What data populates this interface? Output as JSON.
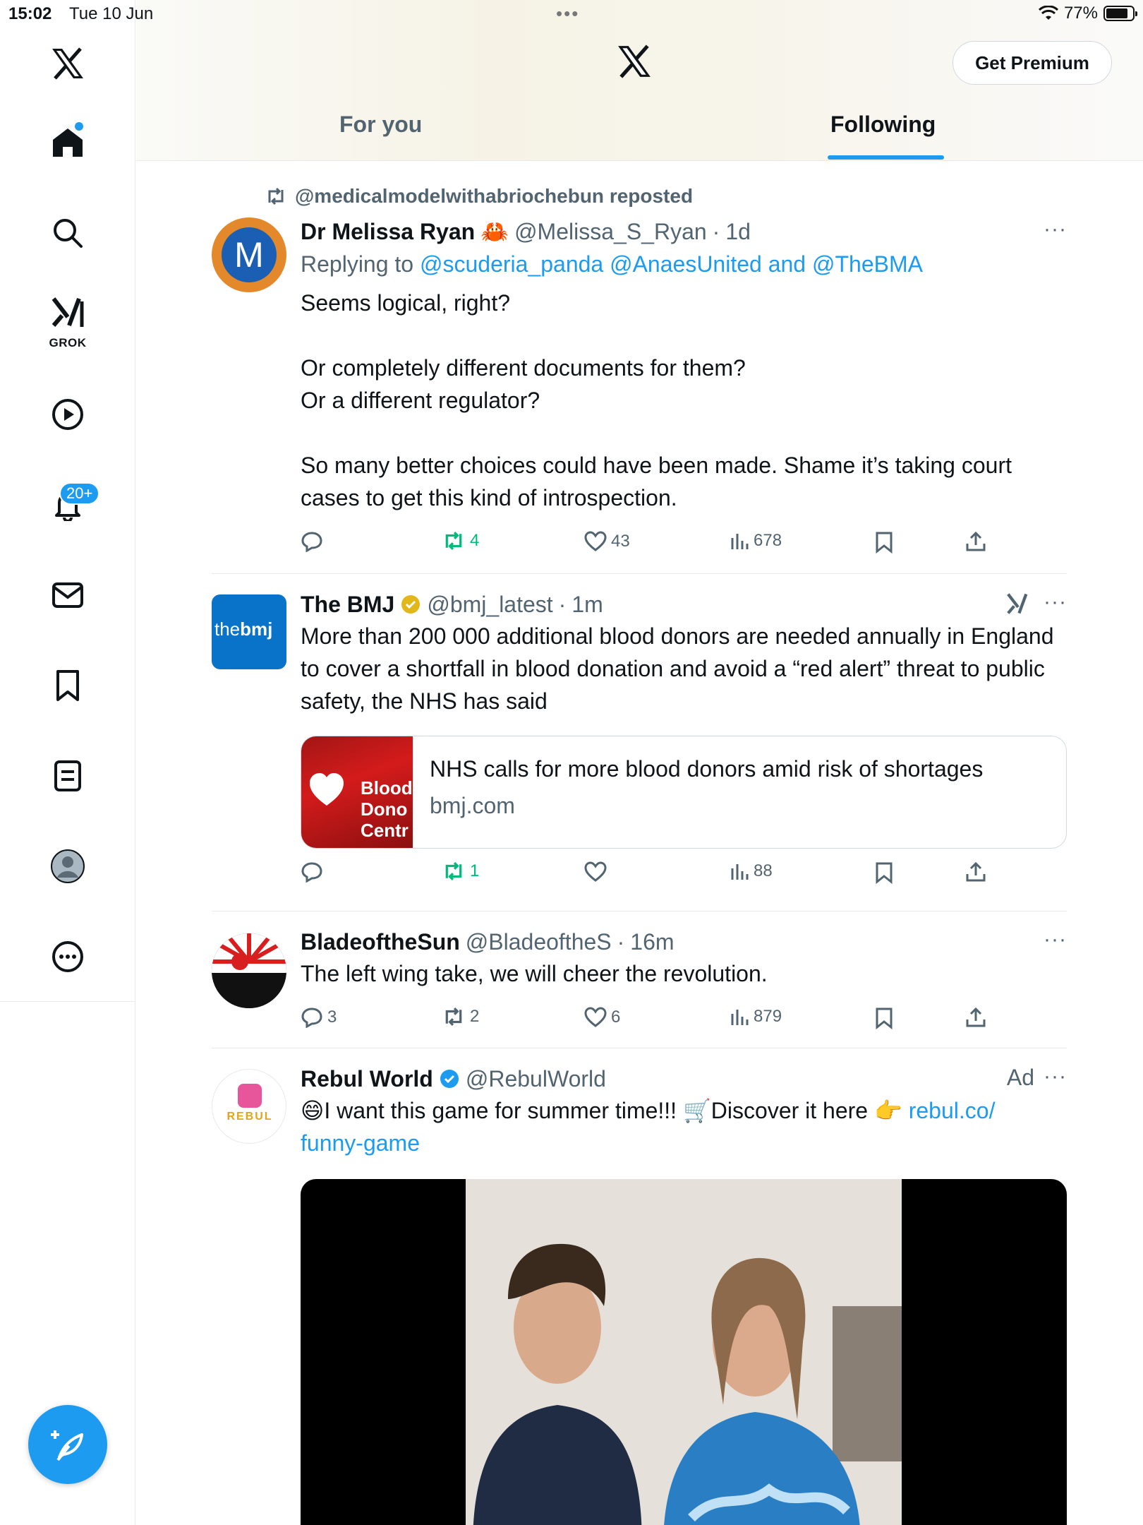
{
  "status_bar": {
    "time": "15:02",
    "date": "Tue 10 Jun",
    "battery": "77%"
  },
  "sidebar": {
    "grok_label": "GROK",
    "notifications_badge": "20+"
  },
  "header": {
    "premium_label": "Get Premium",
    "tabs": [
      {
        "label": "For you"
      },
      {
        "label": "Following",
        "active": true
      }
    ]
  },
  "tweets": [
    {
      "repost_line": "@medicalmodelwithabriochebun reposted",
      "name": "Dr Melissa Ryan",
      "name_emoji": "🦀",
      "handle": "@Melissa_S_Ryan",
      "time": "1d",
      "replying_prefix": "Replying to",
      "replying_to": "@scuderia_panda @AnaesUnited and @TheBMA",
      "text": "Seems logical, right?\n\nOr completely different documents for them?\nOr a different regulator?\n\nSo many better choices could have been made. Shame it’s taking court cases to get this kind of introspection.",
      "avatar_letter": "M",
      "reposts": "4",
      "likes": "43",
      "views": "678"
    },
    {
      "name": "The BMJ",
      "handle": "@bmj_latest",
      "time": "1m",
      "text": "More than 200 000 additional blood donors are needed annually in England to cover a shortfall in blood donation and avoid a “red alert” threat to public safety, the NHS has said",
      "avatar_text_a": "the",
      "avatar_text_b": "bmj",
      "card_title": "NHS calls for more blood donors amid risk of shortages",
      "card_domain": "bmj.com",
      "card_image_text": "Blood\nDono\nCentr",
      "reposts": "1",
      "views": "88"
    },
    {
      "name": "BladeoftheSun",
      "handle": "@BladeoftheS",
      "time": "16m",
      "text": "The left wing take, we will cheer the revolution.",
      "replies": "3",
      "reposts": "2",
      "likes": "6",
      "views": "879"
    },
    {
      "name": "Rebul World",
      "handle": "@RebulWorld",
      "ad_label": "Ad",
      "text_prefix": "😄I want this game for summer time!!! 🛒Discover it here 👉 ",
      "text_link_a": "rebul.co/",
      "text_link_b": "funny-game",
      "avatar_text": "REBUL"
    }
  ],
  "icons": {
    "colors": {
      "accent": "#1d9bf0",
      "repost_green": "#00ba7c",
      "muted": "#536471"
    }
  }
}
